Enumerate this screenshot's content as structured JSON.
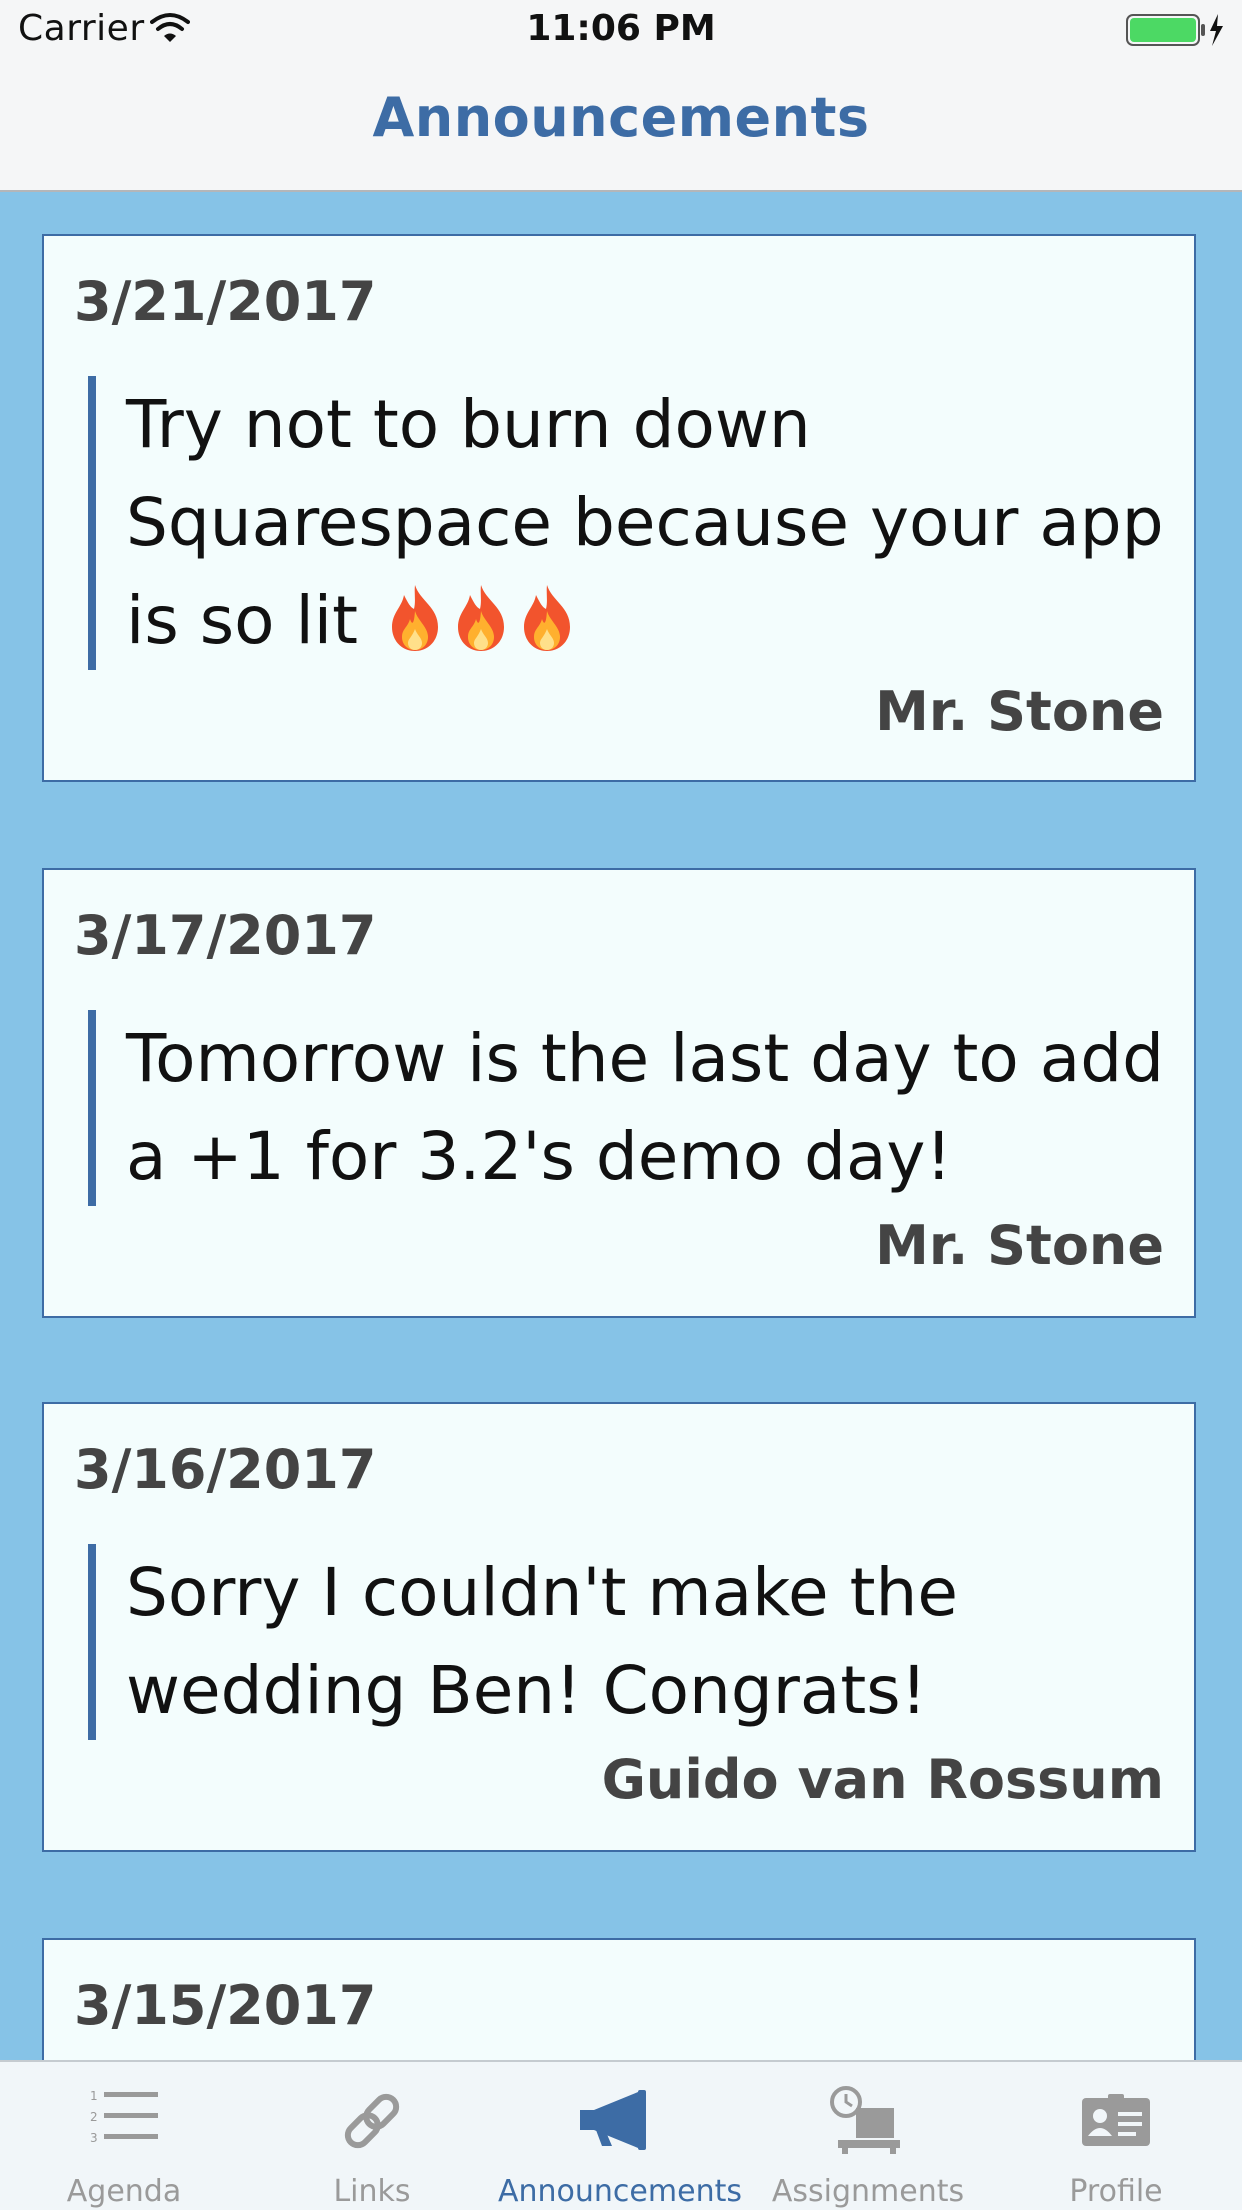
{
  "status_bar": {
    "carrier": "Carrier",
    "time": "11:06 PM"
  },
  "header": {
    "title": "Announcements"
  },
  "announcements": [
    {
      "date": "3/21/2017",
      "message_lines": [
        "Try not to burn down",
        "Squarespace because your app",
        "is so lit"
      ],
      "emoji": [
        "fire",
        "fire",
        "fire"
      ],
      "author": "Mr. Stone"
    },
    {
      "date": "3/17/2017",
      "message_lines": [
        "Tomorrow is the last day to add",
        "a +1 for 3.2's demo day!"
      ],
      "author": "Mr. Stone"
    },
    {
      "date": "3/16/2017",
      "message_lines": [
        "Sorry I couldn't make the",
        "wedding Ben! Congrats!"
      ],
      "author": "Guido van Rossum"
    },
    {
      "date": "3/15/2017"
    }
  ],
  "tab_bar": {
    "tabs": [
      {
        "label": "Agenda",
        "icon": "numbered-list-icon",
        "active": false
      },
      {
        "label": "Links",
        "icon": "link-icon",
        "active": false
      },
      {
        "label": "Announcements",
        "icon": "megaphone-icon",
        "active": true
      },
      {
        "label": "Assignments",
        "icon": "clock-desk-icon",
        "active": false
      },
      {
        "label": "Profile",
        "icon": "id-card-icon",
        "active": false
      }
    ]
  },
  "colors": {
    "accent": "#3d6ca5",
    "feed_background": "#86c3e7",
    "card_background": "#f3fdfd",
    "battery_green": "#4cd964"
  }
}
